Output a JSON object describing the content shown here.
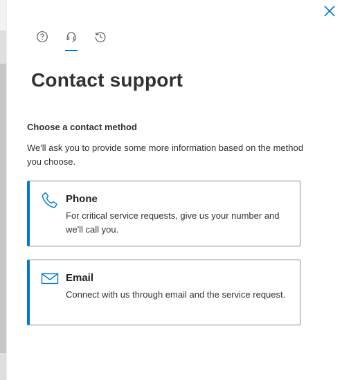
{
  "tabs": [
    {
      "name": "help",
      "icon": "question-circle-icon",
      "active": false
    },
    {
      "name": "contact-support",
      "icon": "headset-icon",
      "active": true
    },
    {
      "name": "history",
      "icon": "history-icon",
      "active": false
    }
  ],
  "title": "Contact support",
  "section": {
    "heading": "Choose a contact method",
    "description": "We'll ask you to provide some more information based on the method you choose."
  },
  "methods": [
    {
      "id": "phone",
      "icon": "phone-icon",
      "title": "Phone",
      "description": "For critical service requests, give us your number and we'll call you."
    },
    {
      "id": "email",
      "icon": "mail-icon",
      "title": "Email",
      "description": "Connect with us through email and the service request."
    }
  ],
  "colors": {
    "accent": "#0078d4",
    "text": "#323130",
    "border": "#8a8886"
  }
}
